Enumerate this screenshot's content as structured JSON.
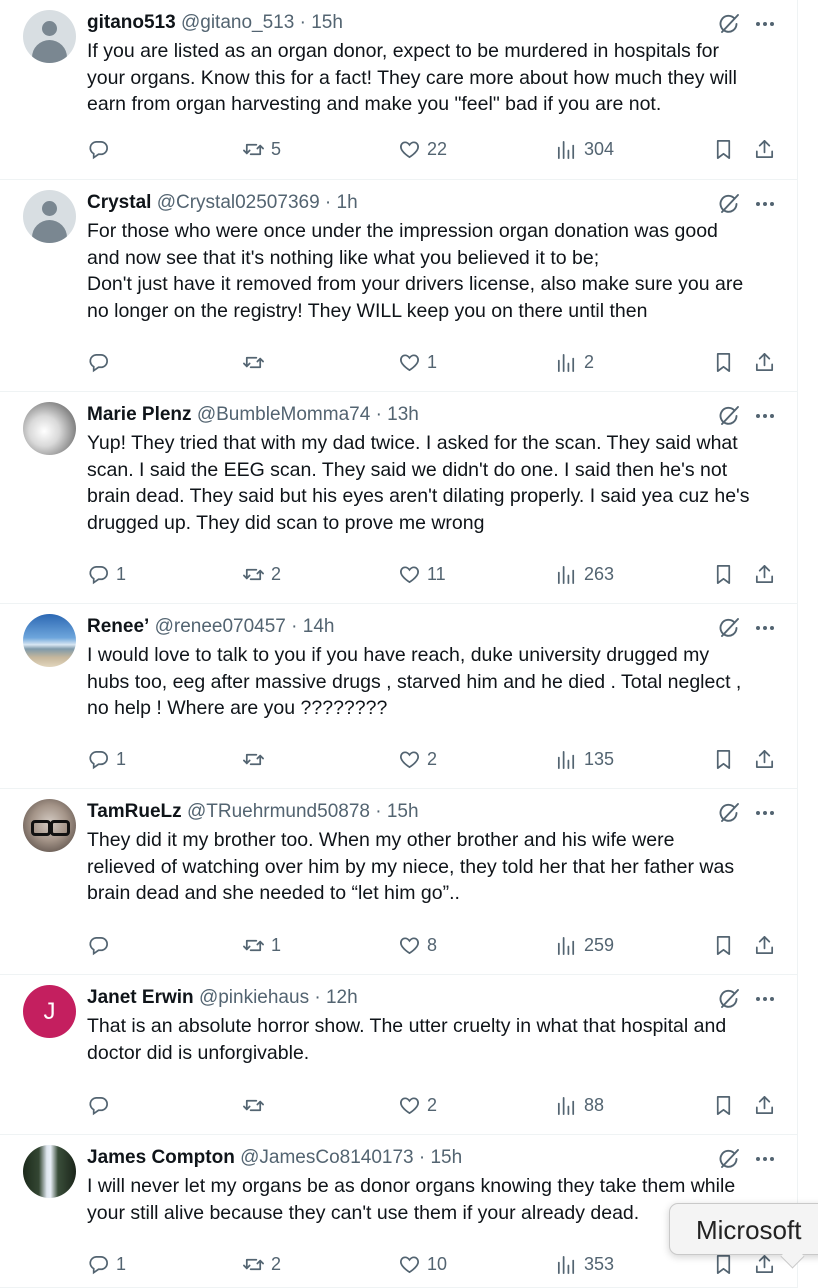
{
  "tweets": [
    {
      "name": "gitano513",
      "handle": "@gitano_513 · 15h",
      "avatar": "default-avatar",
      "text": "If you are listed as an organ donor, expect to be murdered in hospitals for\nyour organs. Know this for a fact!  They care more about how much they will\nearn from organ harvesting and make you \"feel\" bad if you are not.",
      "replies": "",
      "retweets": "5",
      "likes": "22",
      "views": "304"
    },
    {
      "name": "Crystal",
      "handle": "@Crystal02507369 · 1h",
      "avatar": "default-avatar",
      "text": "For those who were once under the impression organ donation was good\nand now see that it's nothing like what you believed it to be;\nDon't just have it removed from your drivers license, also make sure you are\nno longer on the registry! They WILL keep you on there until then",
      "replies": "",
      "retweets": "",
      "likes": "1",
      "views": "2"
    },
    {
      "name": "Marie Plenz",
      "handle": "@BumbleMomma74 · 13h",
      "avatar": "photo-baby-feet",
      "text": "Yup! They tried that with my dad twice. I asked for the scan. They said what\nscan. I said the EEG scan. They said we didn't do one. I said then he's not\nbrain dead. They said but his eyes aren't dilating properly. I said yea cuz he's\ndrugged up. They did scan to prove me wrong",
      "replies": "1",
      "retweets": "2",
      "likes": "11",
      "views": "263"
    },
    {
      "name": "Renee’",
      "handle": "@renee070457 · 14h",
      "avatar": "photo-beach",
      "text": "I would love to talk to you if you have reach, duke university drugged my\nhubs too, eeg after massive drugs , starved him and he died . Total neglect ,\nno help ! Where are you ????????",
      "replies": "1",
      "retweets": "",
      "likes": "2",
      "views": "135"
    },
    {
      "name": "TamRueLz",
      "handle": "@TRuehrmund50878 · 15h",
      "avatar": "photo-glasses",
      "text": "They did it my brother too. When my other brother and his wife were\nrelieved of watching over him by my niece, they told her that her father was\nbrain dead and she needed to “let him go”..",
      "replies": "",
      "retweets": "1",
      "likes": "8",
      "views": "259"
    },
    {
      "name": "Janet Erwin",
      "handle": "@pinkiehaus · 12h",
      "avatar": "letter-avatar",
      "avatar_letter": "J",
      "text": "That is an absolute horror show. The utter cruelty in what that hospital and\ndoctor did is unforgivable.",
      "replies": "",
      "retweets": "",
      "likes": "2",
      "views": "88"
    },
    {
      "name": "James Compton",
      "handle": "@JamesCo8140173 · 15h",
      "avatar": "photo-waterfall",
      "text": "I will never let my organs be as donor organs knowing they take them while\nyour still alive because they can't use them if your already dead.",
      "replies": "1",
      "retweets": "2",
      "likes": "10",
      "views": "353"
    }
  ],
  "tooltip": {
    "label": "Microsoft"
  },
  "colors": {
    "text": "#0f1419",
    "secondary": "#536471",
    "divider": "#eff3f4",
    "letter_avatar": "#c41f5f"
  }
}
